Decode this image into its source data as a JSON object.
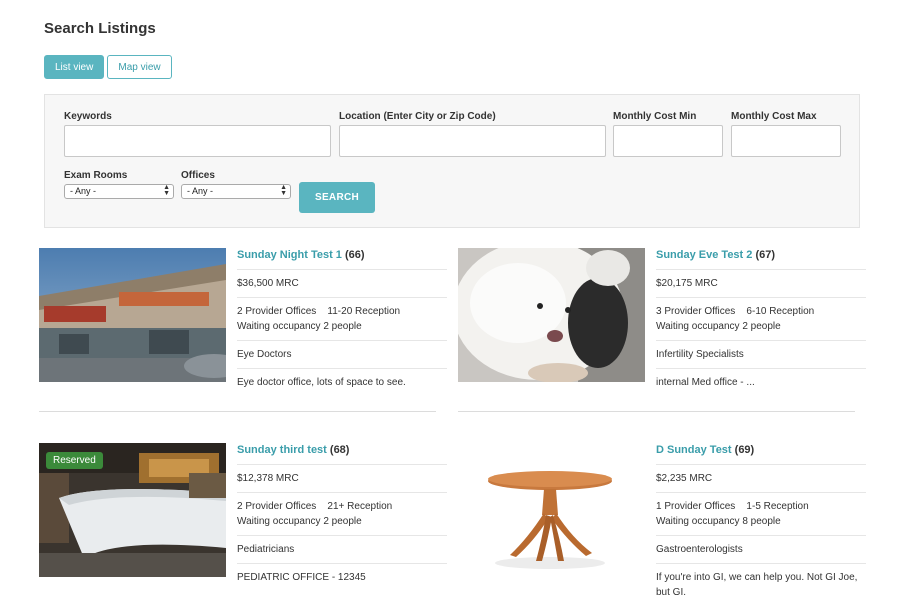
{
  "page": {
    "title": "Search Listings"
  },
  "view_toggle": {
    "list_label": "List view",
    "map_label": "Map view",
    "active": "list"
  },
  "filters": {
    "keywords_label": "Keywords",
    "location_label": "Location (Enter City or Zip Code)",
    "cost_min_label": "Monthly Cost Min",
    "cost_max_label": "Monthly Cost Max",
    "exam_rooms_label": "Exam Rooms",
    "exam_rooms_value": "- Any -",
    "offices_label": "Offices",
    "offices_value": "- Any -",
    "search_label": "SEARCH"
  },
  "listings": [
    {
      "name": "Sunday Night Test 1",
      "id": "(66)",
      "price": "$36,500 MRC",
      "offices": "2 Provider Offices",
      "reception": "11-20 Reception",
      "occupancy": "Waiting occupancy 2 people",
      "specialty": "Eye Doctors",
      "description": "Eye doctor office, lots of space to see.",
      "image": "storefront-photo",
      "badge": ""
    },
    {
      "name": "Sunday Eve Test 2",
      "id": "(67)",
      "price": "$20,175 MRC",
      "offices": "3 Provider Offices",
      "reception": "6-10 Reception",
      "occupancy": "Waiting occupancy 2 people",
      "specialty": "Infertility Specialists",
      "description": "internal Med office - ...",
      "image": "dog-photo",
      "badge": ""
    },
    {
      "name": "Sunday third test",
      "id": "(68)",
      "price": "$12,378 MRC",
      "offices": "2 Provider Offices",
      "reception": "21+ Reception",
      "occupancy": "Waiting occupancy 2 people",
      "specialty": "Pediatricians",
      "description": "PEDIATRIC OFFICE - 12345",
      "image": "reception-desk-photo",
      "badge": "Reserved"
    },
    {
      "name": "D Sunday Test",
      "id": "(69)",
      "price": "$2,235 MRC",
      "offices": "1 Provider Offices",
      "reception": "1-5 Reception",
      "occupancy": "Waiting occupancy 8 people",
      "specialty": "Gastroenterologists",
      "description": "If you're into GI, we can help you. Not GI Joe, but GI.",
      "image": "table-photo",
      "badge": ""
    }
  ],
  "colors": {
    "accent": "#5ab5c0",
    "link": "#3a9daa",
    "reserved": "#3b8a3a"
  }
}
